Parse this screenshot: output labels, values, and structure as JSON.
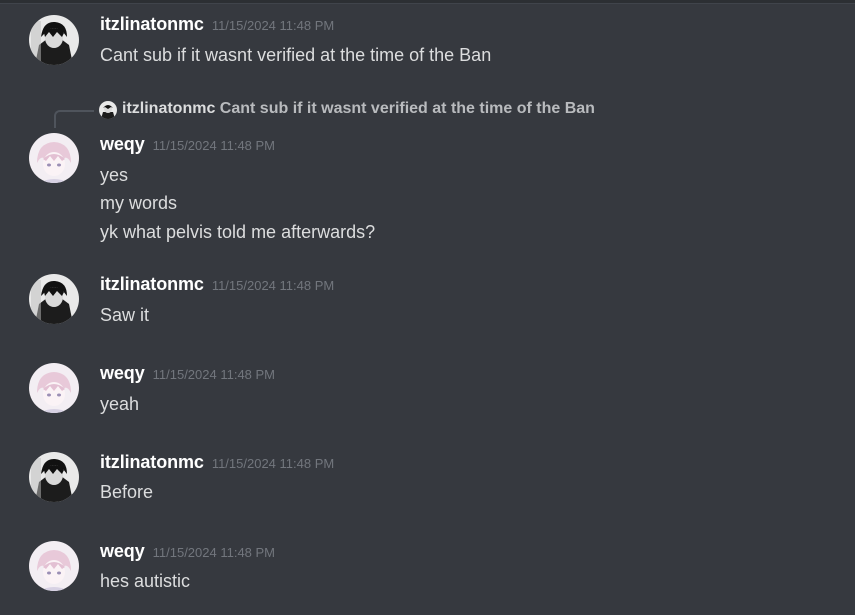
{
  "messages": [
    {
      "username": "itzlinatonmc",
      "timestamp": "11/15/2024 11:48 PM",
      "avatar_icon": "dark-anime-avatar-icon",
      "lines": [
        "Cant sub if it wasnt verified at the time of the Ban"
      ]
    },
    {
      "reply_to": {
        "username": "itzlinatonmc",
        "text": "Cant sub if it wasnt verified at the time of the Ban"
      },
      "username": "weqy",
      "timestamp": "11/15/2024 11:48 PM",
      "avatar_icon": "pink-anime-avatar-icon",
      "lines": [
        "yes",
        "my words",
        "yk what pelvis told me afterwards?"
      ]
    },
    {
      "username": "itzlinatonmc",
      "timestamp": "11/15/2024 11:48 PM",
      "avatar_icon": "dark-anime-avatar-icon",
      "lines": [
        "Saw it"
      ]
    },
    {
      "username": "weqy",
      "timestamp": "11/15/2024 11:48 PM",
      "avatar_icon": "pink-anime-avatar-icon",
      "lines": [
        "yeah"
      ]
    },
    {
      "username": "itzlinatonmc",
      "timestamp": "11/15/2024 11:48 PM",
      "avatar_icon": "dark-anime-avatar-icon",
      "lines": [
        "Before"
      ]
    },
    {
      "username": "weqy",
      "timestamp": "11/15/2024 11:48 PM",
      "avatar_icon": "pink-anime-avatar-icon",
      "lines": [
        "hes autistic"
      ]
    }
  ],
  "colors": {
    "background": "#36393f",
    "username": "#ffffff",
    "timestamp": "#72767d",
    "message_text": "#dcddde",
    "reply_spine": "#4f545c"
  }
}
